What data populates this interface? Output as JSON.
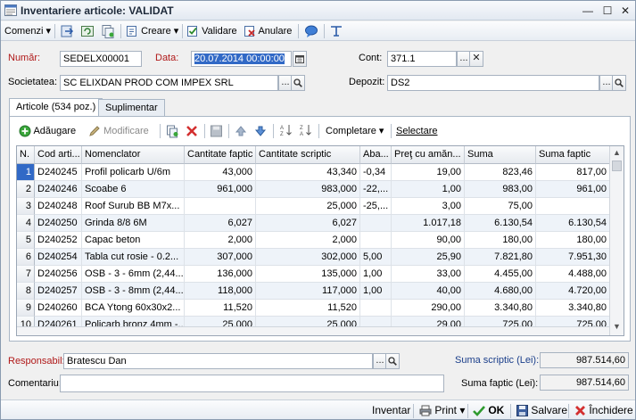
{
  "window": {
    "title": "Inventariere articole: VALIDAT"
  },
  "toolbar": {
    "commands_label": "Comenzi",
    "create_label": "Creare",
    "validate_label": "Validare",
    "cancel_label": "Anulare"
  },
  "header": {
    "number_label": "Număr:",
    "number_value": "SEDELX00001",
    "date_label": "Data:",
    "date_value": "20.07.2014 00:00:00",
    "account_label": "Cont:",
    "account_value": "371.1",
    "company_label": "Societatea:",
    "company_value": "SC ELIXDAN PROD COM IMPEX SRL",
    "warehouse_label": "Depozit:",
    "warehouse_value": "DS2"
  },
  "tabs": [
    {
      "label": "Articole (534 poz.)"
    },
    {
      "label": "Suplimentar"
    }
  ],
  "grid_toolbar": {
    "add_label": "Adăugare",
    "modify_label": "Modificare",
    "complete_label": "Completare",
    "select_label": "Selectare"
  },
  "grid": {
    "columns": [
      "N.",
      "Cod arti...",
      "Nomenclator",
      "Cantitate faptic",
      "Cantitate scriptic",
      "Aba...",
      "Preţ cu amăn...",
      "Suma",
      "Suma faptic"
    ],
    "rows": [
      {
        "n": "1",
        "code": "D240245",
        "name": "Profil policarb U/6m",
        "qty_fact": "43,000",
        "qty_script": "43,340",
        "diff": "-0,34",
        "price": "19,00",
        "sum": "823,46",
        "sum_fact": "817,00"
      },
      {
        "n": "2",
        "code": "D240246",
        "name": "Scoabe 6",
        "qty_fact": "961,000",
        "qty_script": "983,000",
        "diff": "-22,...",
        "price": "1,00",
        "sum": "983,00",
        "sum_fact": "961,00"
      },
      {
        "n": "3",
        "code": "D240248",
        "name": "Roof Surub BB M7x...",
        "qty_fact": "",
        "qty_script": "25,000",
        "diff": "-25,...",
        "price": "3,00",
        "sum": "75,00",
        "sum_fact": ""
      },
      {
        "n": "4",
        "code": "D240250",
        "name": "Grinda 8/8 6M",
        "qty_fact": "6,027",
        "qty_script": "6,027",
        "diff": "",
        "price": "1.017,18",
        "sum": "6.130,54",
        "sum_fact": "6.130,54"
      },
      {
        "n": "5",
        "code": "D240252",
        "name": "Capac beton",
        "qty_fact": "2,000",
        "qty_script": "2,000",
        "diff": "",
        "price": "90,00",
        "sum": "180,00",
        "sum_fact": "180,00"
      },
      {
        "n": "6",
        "code": "D240254",
        "name": "Tabla cut rosie - 0.2...",
        "qty_fact": "307,000",
        "qty_script": "302,000",
        "diff": "5,00",
        "price": "25,90",
        "sum": "7.821,80",
        "sum_fact": "7.951,30"
      },
      {
        "n": "7",
        "code": "D240256",
        "name": "OSB - 3 - 6mm (2,44...",
        "qty_fact": "136,000",
        "qty_script": "135,000",
        "diff": "1,00",
        "price": "33,00",
        "sum": "4.455,00",
        "sum_fact": "4.488,00"
      },
      {
        "n": "8",
        "code": "D240257",
        "name": "OSB - 3 - 8mm (2,44...",
        "qty_fact": "118,000",
        "qty_script": "117,000",
        "diff": "1,00",
        "price": "40,00",
        "sum": "4.680,00",
        "sum_fact": "4.720,00"
      },
      {
        "n": "9",
        "code": "D240260",
        "name": "BCA Ytong 60x30x2...",
        "qty_fact": "11,520",
        "qty_script": "11,520",
        "diff": "",
        "price": "290,00",
        "sum": "3.340,80",
        "sum_fact": "3.340,80"
      },
      {
        "n": "10",
        "code": "D240261",
        "name": "Policarb bronz 4mm -...",
        "qty_fact": "25,000",
        "qty_script": "25,000",
        "diff": "",
        "price": "29,00",
        "sum": "725,00",
        "sum_fact": "725,00"
      }
    ]
  },
  "footer": {
    "responsible_label": "Responsabil:",
    "responsible_value": "Bratescu Dan",
    "comment_label": "Comentariu:",
    "comment_value": "",
    "sum_script_label": "Suma scriptic (Lei):",
    "sum_script_value": "987.514,60",
    "sum_fact_label": "Suma faptic (Lei):",
    "sum_fact_value": "987.514,60"
  },
  "bottombar": {
    "inventory_label": "Inventar",
    "print_label": "Print",
    "ok_label": "OK",
    "save_label": "Salvare",
    "close_label": "Închidere"
  },
  "colors": {
    "accent": "#3169c6",
    "label_red": "#b01818",
    "label_blue": "#1a3e8a",
    "row_alt": "#eef3f9"
  }
}
